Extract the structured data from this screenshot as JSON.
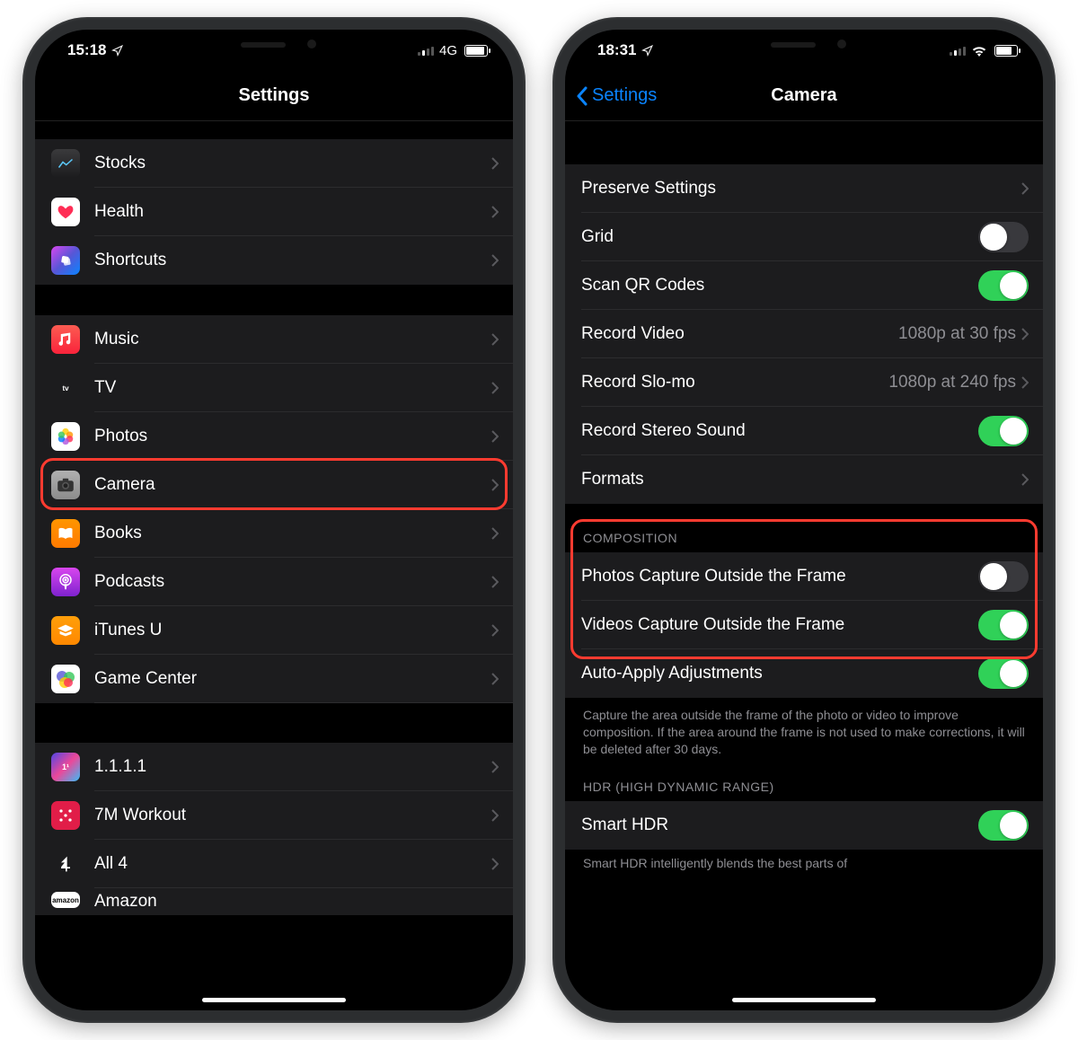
{
  "left": {
    "status_time": "15:18",
    "network": "4G",
    "title": "Settings",
    "group1": [
      {
        "label": "Stocks"
      },
      {
        "label": "Health"
      },
      {
        "label": "Shortcuts"
      }
    ],
    "group2": [
      {
        "label": "Music"
      },
      {
        "label": "TV"
      },
      {
        "label": "Photos"
      },
      {
        "label": "Camera"
      },
      {
        "label": "Books"
      },
      {
        "label": "Podcasts"
      },
      {
        "label": "iTunes U"
      },
      {
        "label": "Game Center"
      }
    ],
    "group3": [
      {
        "label": "1.1.1.1"
      },
      {
        "label": "7M Workout"
      },
      {
        "label": "All 4"
      },
      {
        "label": "Amazon"
      }
    ]
  },
  "right": {
    "status_time": "18:31",
    "back_label": "Settings",
    "title": "Camera",
    "group1": {
      "preserve": "Preserve Settings",
      "grid": "Grid",
      "scanqr": "Scan QR Codes",
      "record_video": "Record Video",
      "record_video_detail": "1080p at 30 fps",
      "record_slomo": "Record Slo-mo",
      "record_slomo_detail": "1080p at 240 fps",
      "stereo": "Record Stereo Sound",
      "formats": "Formats"
    },
    "section_composition": "COMPOSITION",
    "photos_outside": "Photos Capture Outside the Frame",
    "videos_outside": "Videos Capture Outside the Frame",
    "auto_apply": "Auto-Apply Adjustments",
    "composition_footer": "Capture the area outside the frame of the photo or video to improve composition. If the area around the frame is not used to make corrections, it will be deleted after 30 days.",
    "section_hdr": "HDR (HIGH DYNAMIC RANGE)",
    "smart_hdr": "Smart HDR",
    "hdr_footer": "Smart HDR intelligently blends the best parts of"
  }
}
